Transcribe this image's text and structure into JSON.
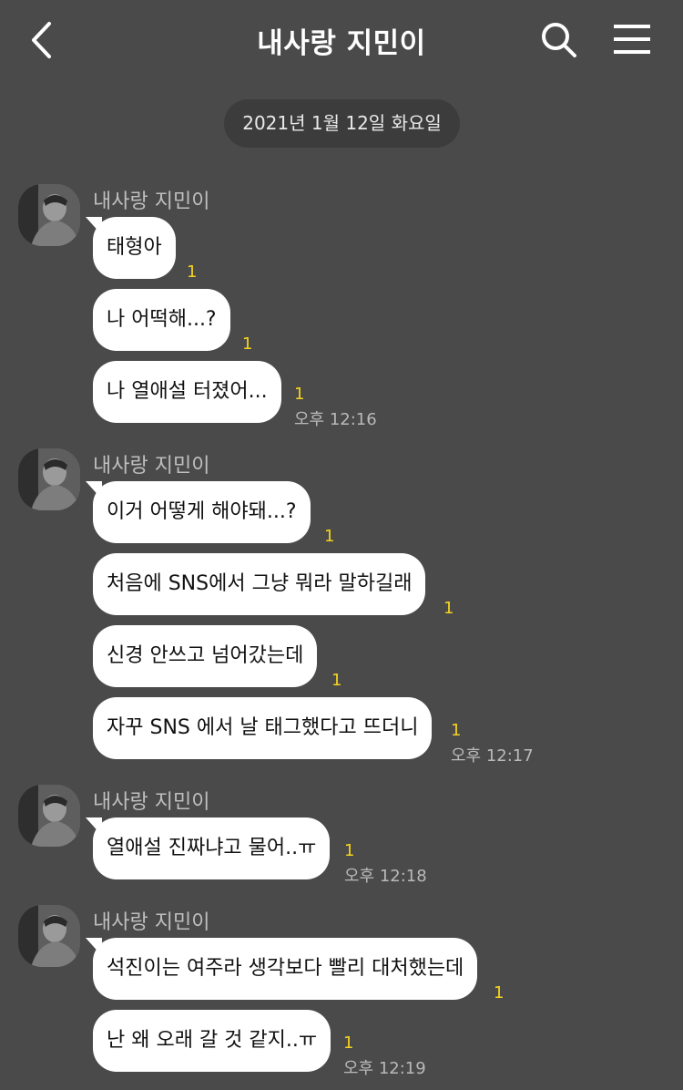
{
  "header": {
    "title": "내사랑 지민이"
  },
  "date_divider": "2021년 1월 12일 화요일",
  "groups": [
    {
      "sender": "내사랑 지민이",
      "messages": [
        {
          "text": "태형아",
          "unread": "1"
        },
        {
          "text": "나 어떡해...?",
          "unread": "1"
        },
        {
          "text": "나 열애설 터졌어...",
          "unread": "1"
        }
      ],
      "time": "오후 12:16"
    },
    {
      "sender": "내사랑 지민이",
      "messages": [
        {
          "text": "이거 어떻게 해야돼...?",
          "unread": "1"
        },
        {
          "text": "처음에 SNS에서 그냥 뭐라 말하길래",
          "unread": "1"
        },
        {
          "text": "신경 안쓰고 넘어갔는데",
          "unread": "1"
        },
        {
          "text": "자꾸 SNS 에서 날 태그했다고 뜨더니",
          "unread": "1"
        }
      ],
      "time": "오후 12:17"
    },
    {
      "sender": "내사랑 지민이",
      "messages": [
        {
          "text": "열애설 진짜냐고 물어..ㅠ",
          "unread": "1"
        }
      ],
      "time": "오후 12:18"
    },
    {
      "sender": "내사랑 지민이",
      "messages": [
        {
          "text": "석진이는 여주라 생각보다 빨리 대처했는데",
          "unread": "1"
        },
        {
          "text": "난 왜 오래 갈 것 같지..ㅠ",
          "unread": "1"
        }
      ],
      "time": "오후 12:19"
    }
  ],
  "colors": {
    "background": "#4a4a4b",
    "bubble": "#ffffff",
    "unread": "#f5d320"
  }
}
